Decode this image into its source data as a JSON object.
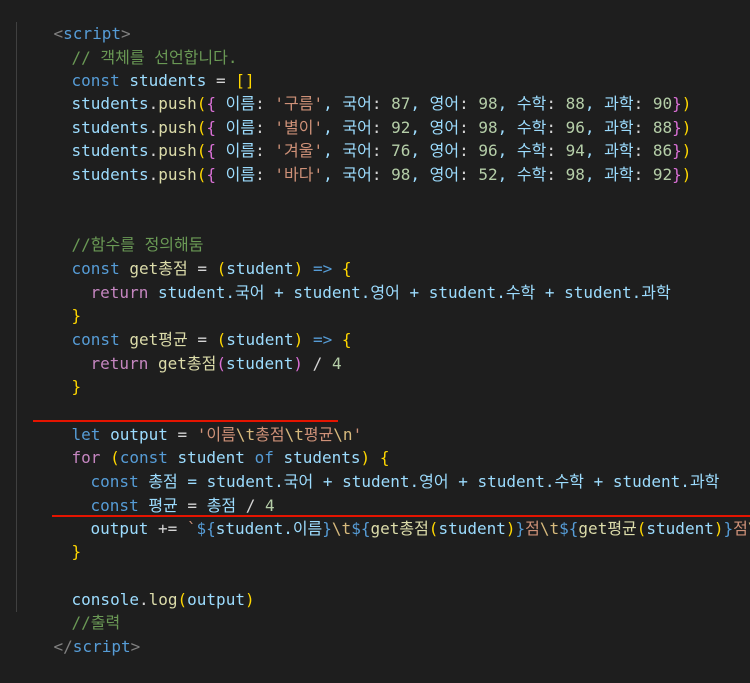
{
  "lines": {
    "l1": {
      "open": "<",
      "name": "script",
      "close": ">"
    },
    "l2": {
      "comment": "// 객체를 선언합니다."
    },
    "l3": {
      "kw": "const",
      "sp": " ",
      "var": "students",
      "op": " = ",
      "br": "[]"
    },
    "push_rows": [
      {
        "obj": "students",
        "dot": ".",
        "fn": "push",
        "p1": "(",
        "b1": "{",
        "k1": " 이름",
        "c1": ": ",
        "name": "'구름'",
        "k2": ", 국어",
        "c2": ": ",
        "v2": "87",
        "k3": ", 영어",
        "c3": ": ",
        "v3": "98",
        "k4": ", 수학",
        "c4": ": ",
        "v4": "88",
        "k5": ", 과학",
        "c5": ": ",
        "v5": "90",
        "b2": "}",
        "p2": ")"
      },
      {
        "obj": "students",
        "dot": ".",
        "fn": "push",
        "p1": "(",
        "b1": "{",
        "k1": " 이름",
        "c1": ": ",
        "name": "'별이'",
        "k2": ", 국어",
        "c2": ": ",
        "v2": "92",
        "k3": ", 영어",
        "c3": ": ",
        "v3": "98",
        "k4": ", 수학",
        "c4": ": ",
        "v4": "96",
        "k5": ", 과학",
        "c5": ": ",
        "v5": "88",
        "b2": "}",
        "p2": ")"
      },
      {
        "obj": "students",
        "dot": ".",
        "fn": "push",
        "p1": "(",
        "b1": "{",
        "k1": " 이름",
        "c1": ": ",
        "name": "'겨울'",
        "k2": ", 국어",
        "c2": ": ",
        "v2": "76",
        "k3": ", 영어",
        "c3": ": ",
        "v3": "96",
        "k4": ", 수학",
        "c4": ": ",
        "v4": "94",
        "k5": ", 과학",
        "c5": ": ",
        "v5": "86",
        "b2": "}",
        "p2": ")"
      },
      {
        "obj": "students",
        "dot": ".",
        "fn": "push",
        "p1": "(",
        "b1": "{",
        "k1": " 이름",
        "c1": ": ",
        "name": "'바다'",
        "k2": ", 국어",
        "c2": ": ",
        "v2": "98",
        "k3": ", 영어",
        "c3": ": ",
        "v3": "52",
        "k4": ", 수학",
        "c4": ": ",
        "v4": "98",
        "k5": ", 과학",
        "c5": ": ",
        "v5": "92",
        "b2": "}",
        "p2": ")"
      }
    ],
    "l9": {
      "comment": "//함수를 정의해둠"
    },
    "l10": {
      "kw": "const",
      "fn": " get총점",
      "op": " = ",
      "p1": "(",
      "param": "student",
      "p2": ")",
      "arrow": " => ",
      "b": "{"
    },
    "l11": {
      "kw": "return",
      "rest": " student.국어 + student.영어 + student.수학 + student.과학"
    },
    "l12": {
      "b": "}"
    },
    "l13": {
      "kw": "const",
      "fn": " get평균",
      "op": " = ",
      "p1": "(",
      "param": "student",
      "p2": ")",
      "arrow": " => ",
      "b": "{"
    },
    "l14": {
      "kw": "return",
      "fn": " get총점",
      "p1": "(",
      "param": "student",
      "p2": ")",
      "op": " / ",
      "num": "4"
    },
    "l15": {
      "b": "}"
    },
    "l17": {
      "kw": "let",
      "var": " output",
      "op": " = ",
      "str1": "'이름",
      "esc1": "\\t",
      "str2": "총점",
      "esc2": "\\t",
      "str3": "평균",
      "esc3": "\\n",
      "str4": "'"
    },
    "l18": {
      "kw": "for",
      "p1": " (",
      "kw2": "const",
      "var1": " student",
      "kw3": " of",
      "var2": " students",
      "p2": ")",
      "b": " {"
    },
    "l19": {
      "kw": "const",
      "var": " 총점",
      "rest": " = student.국어 + student.영어 + student.수학 + student.과학"
    },
    "l20": {
      "kw": "const",
      "var": " 평균",
      "op": " = ",
      "var2": "총점",
      "op2": " / ",
      "num": "4"
    },
    "l21": {
      "var": "output",
      "op": " += ",
      "tick": "`",
      "d1": "${",
      "e1": "student.이름",
      "d1c": "}",
      "esc1": "\\t",
      "d2": "${",
      "e2f": "get총점",
      "e2p1": "(",
      "e2a": "student",
      "e2p2": ")",
      "d2c": "}",
      "s2": "점",
      "esc2": "\\t",
      "d3": "${",
      "e3f": "get평균",
      "e3p1": "(",
      "e3a": "student",
      "e3p2": ")",
      "d3c": "}",
      "s3": "점",
      "esc3": "\\n",
      "tick2": "`"
    },
    "l22": {
      "b": "}"
    },
    "l24": {
      "obj": "console",
      "dot": ".",
      "fn": "log",
      "p1": "(",
      "arg": "output",
      "p2": ")"
    },
    "l25": {
      "comment": "//출력"
    },
    "l26": {
      "open": "</",
      "name": "script",
      "close": ">"
    }
  },
  "colors": {
    "background": "#1e1e1e",
    "keyword": "#569cd6",
    "comment": "#6a9955",
    "string": "#ce9178",
    "number": "#b5cea8",
    "function": "#dcdcaa",
    "variable": "#9cdcfe",
    "error_squiggle": "#e51400"
  }
}
